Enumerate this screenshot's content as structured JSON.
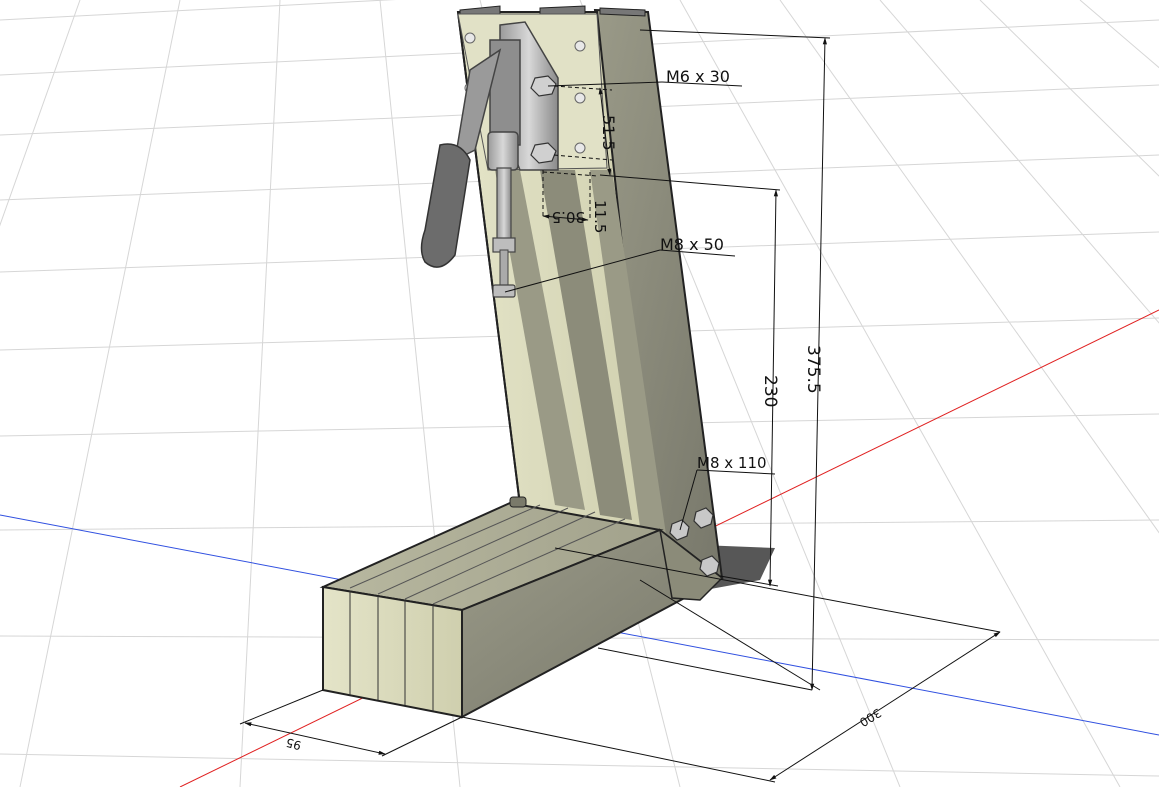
{
  "labels": {
    "screw_m6": "M6  x  30",
    "screw_m8_50": "M8  x  50",
    "screw_m8_110": "M8  x  110"
  },
  "dimensions": {
    "height_total": "375.5",
    "height_clamp": "230",
    "plate_spacing": "51.5",
    "offset_small": "11.5",
    "offset_horizontal": "30.5",
    "base_width": "95",
    "base_length": "300"
  },
  "colors": {
    "axis_red": "#e02020",
    "axis_blue": "#3050e0",
    "wood_light": "#dcdcb8",
    "wood_dark": "#8a8a78",
    "grid": "#d4d4d4"
  },
  "icons": {
    "toggle_clamp": "toggle-clamp-icon",
    "hex_bolt": "hex-bolt-icon"
  }
}
